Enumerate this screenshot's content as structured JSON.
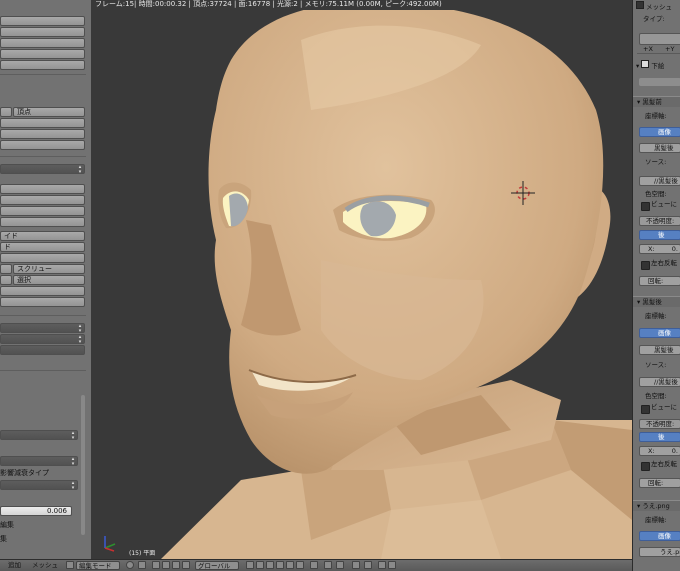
{
  "viewport": {
    "header_text": "フレーム:15| 時間:00:00.32 | 頂点:37724 | 面:16778 | 光源:2 | メモリ:75.11M (0.00M, ピーク:492.00M)",
    "frame_label": "(15) 平面"
  },
  "left_panel": {
    "items": [
      "頂点",
      "イド",
      "ド",
      "スクリュー",
      "選択",
      "影響減衰タイプ",
      "0.006",
      "編集",
      "集"
    ]
  },
  "right_panel": {
    "top_label": "メッシュ",
    "type_label": "タイプ:",
    "add_x": "+X",
    "add_y": "+Y",
    "shita_e": "下絵",
    "section1": {
      "title": "黒髪前",
      "coords_label": "座標軸:",
      "image_btn": "画像",
      "image_name": "黒髪後",
      "source_label": "ソース:",
      "source_path": "//黒髪後",
      "color_space": "色空間:",
      "view_check": "ビューに",
      "opacity": "不透明度:",
      "back_btn": "後",
      "x_label": "X:",
      "x_value": "0.",
      "flip": "左右反転",
      "rotate": "回転:"
    },
    "section2": {
      "title": "黒髪後",
      "coords_label": "座標軸:",
      "image_btn": "画像",
      "image_name": "黒髪後",
      "source_label": "ソース:",
      "source_path": "//黒髪後",
      "color_space": "色空間:",
      "view_check": "ビューに",
      "opacity": "不透明度:",
      "back_btn": "後",
      "x_label": "X:",
      "x_value": "0.",
      "flip": "左右反転",
      "rotate": "回転:"
    },
    "section3": {
      "title": "うえ.png",
      "coords_label": "座標軸:",
      "image_btn": "画像",
      "image_name": "うえ.png"
    }
  },
  "bottom_bar": {
    "add": "追加",
    "mesh": "メッシュ",
    "mode": "編集モード",
    "global": "グローバル"
  },
  "colors": {
    "skin": "#d6b48e",
    "eye_white": "#fbf3c2",
    "iris": "#a3a9ae",
    "accent_blue": "#5680c2"
  }
}
